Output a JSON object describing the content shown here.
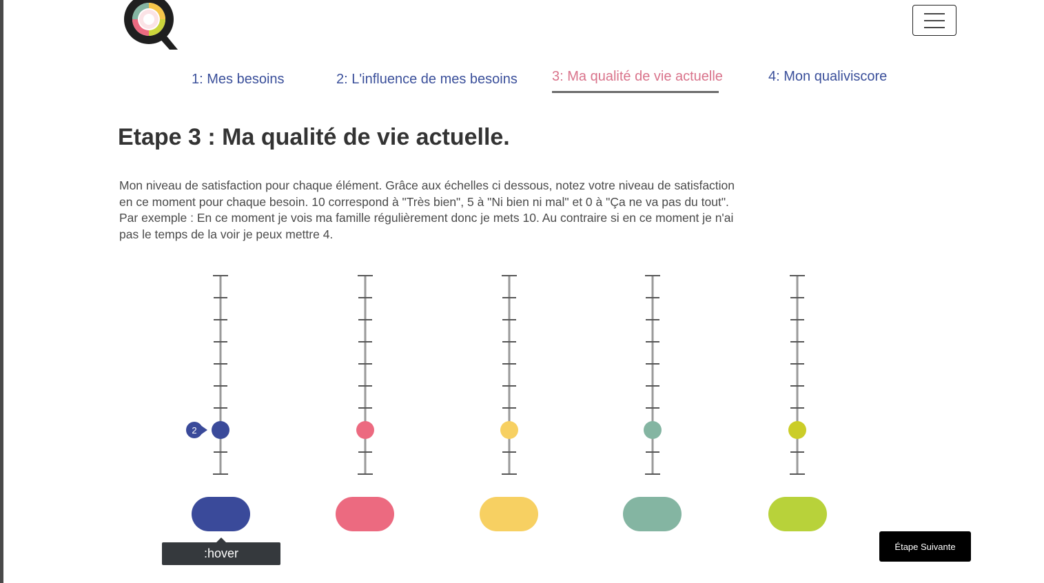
{
  "brand": {
    "logo_letter": "Q"
  },
  "header": {
    "menu_icon": "hamburger-menu-icon"
  },
  "tabs": [
    {
      "label": "1: Mes besoins",
      "active": false
    },
    {
      "label": "2: L'influence de mes besoins",
      "active": false
    },
    {
      "label": "3: Ma qualité de vie actuelle",
      "active": true
    },
    {
      "label": "4: Mon qualiviscore",
      "active": false
    }
  ],
  "page": {
    "title": "Etape 3 : Ma qualité de vie actuelle.",
    "intro_lines": [
      "Mon niveau de satisfaction pour chaque élément. Grâce aux échelles ci dessous, notez votre niveau de satisfaction",
      "en ce moment pour chaque besoin. 10 correspond à \"Très bien\", 5 à \"Ni bien ni mal\" et 0 à \"Ça ne va pas du tout\".",
      "Par exemple : En ce moment je vois ma famille régulièrement donc je mets 10. Au contraire si en ce moment je n'ai",
      "pas le temps de la voir je peux mettre 4."
    ]
  },
  "scale": {
    "min": 0,
    "max": 9
  },
  "sliders": [
    {
      "color": "#3a4a9a",
      "value": 2,
      "value_label": "2",
      "show_value": true
    },
    {
      "color": "#ec6a80",
      "value": 2,
      "show_value": false
    },
    {
      "color": "#f7d062",
      "value": 2,
      "show_value": false
    },
    {
      "color": "#84b5a2",
      "value": 2,
      "show_value": false
    },
    {
      "color": "#cbcd28",
      "value": 2,
      "show_value": false
    }
  ],
  "category_buttons": [
    {
      "color": "#3a4a9a"
    },
    {
      "color": "#ec6a80"
    },
    {
      "color": "#f7d062"
    },
    {
      "color": "#84b5a2"
    },
    {
      "color": "#b8d23a"
    }
  ],
  "hover_tooltip": ":hover",
  "next_button": {
    "label": "Étape Suivante"
  },
  "colors": {
    "nav": "#3a4f9a",
    "active_tab": "#d9738b",
    "track": "#9a9a9a"
  }
}
